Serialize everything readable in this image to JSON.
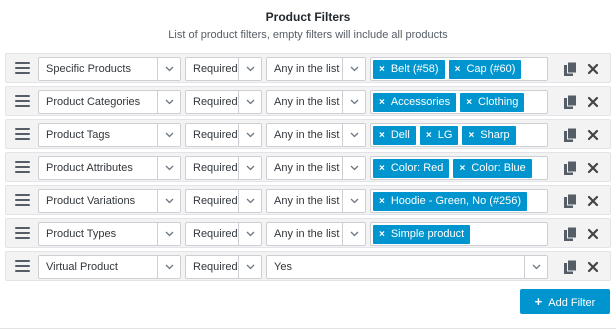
{
  "header": {
    "title": "Product Filters",
    "subtitle": "List of product filters, empty filters will include all products"
  },
  "filters": [
    {
      "field": "Specific Products",
      "requirement": "Required",
      "comparison": "Any in the list",
      "tags": [
        "Belt (#58)",
        "Cap (#60)"
      ]
    },
    {
      "field": "Product Categories",
      "requirement": "Required",
      "comparison": "Any in the list",
      "tags": [
        "Accessories",
        "Clothing"
      ]
    },
    {
      "field": "Product Tags",
      "requirement": "Required",
      "comparison": "Any in the list",
      "tags": [
        "Dell",
        "LG",
        "Sharp"
      ]
    },
    {
      "field": "Product Attributes",
      "requirement": "Required",
      "comparison": "Any in the list",
      "tags": [
        "Color: Red",
        "Color: Blue"
      ]
    },
    {
      "field": "Product Variations",
      "requirement": "Required",
      "comparison": "Any in the list",
      "tags": [
        "Hoodie - Green, No (#256)"
      ]
    },
    {
      "field": "Product Types",
      "requirement": "Required",
      "comparison": "Any in the list",
      "tags": [
        "Simple product"
      ]
    },
    {
      "field": "Virtual Product",
      "requirement": "Required",
      "value": "Yes"
    }
  ],
  "tag_remove_glyph": "×",
  "add_button": {
    "icon": "+",
    "label": "Add Filter"
  },
  "icons": {
    "drag": "drag-handle-icon",
    "copy": "duplicate-icon",
    "delete": "close-icon",
    "dropdown": "chevron-down-icon"
  },
  "colors": {
    "accent": "#0095cf",
    "row_bg": "#f3f3f3"
  }
}
